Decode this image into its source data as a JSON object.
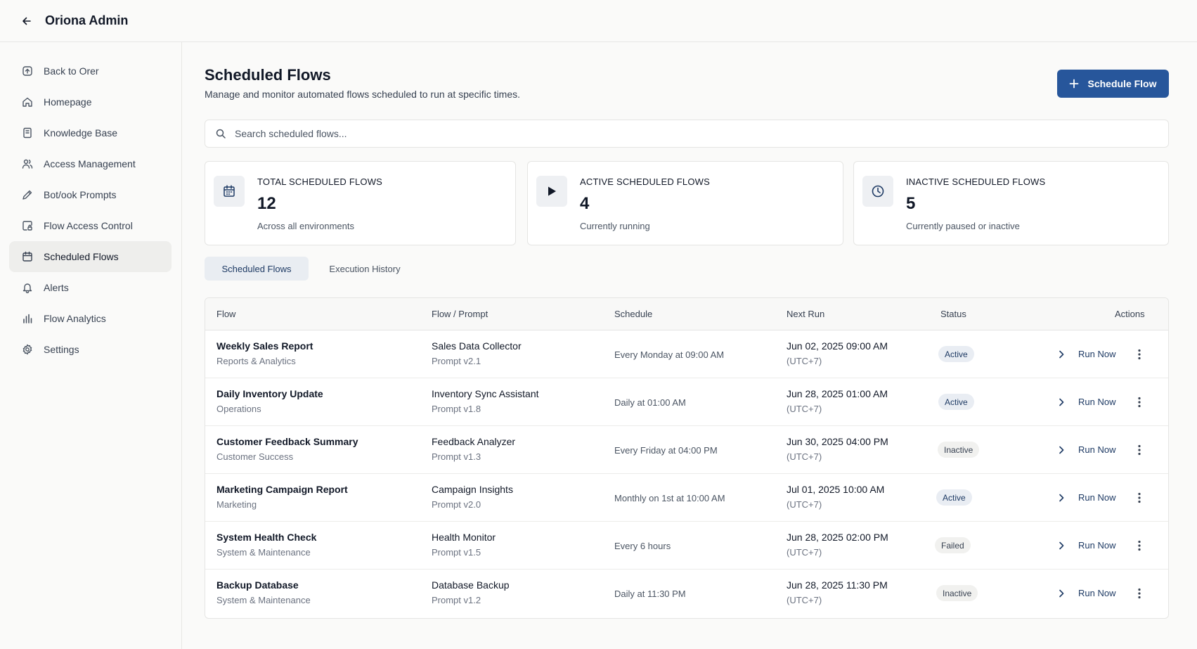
{
  "app": {
    "title": "Oriona Admin"
  },
  "sidebar": {
    "items": [
      {
        "label": "Back to Orer",
        "icon": "back-box-icon",
        "active": false
      },
      {
        "label": "Homepage",
        "icon": "home-icon",
        "active": false
      },
      {
        "label": "Knowledge Base",
        "icon": "book-icon",
        "active": false
      },
      {
        "label": "Access Management",
        "icon": "users-icon",
        "active": false
      },
      {
        "label": "Bot/ook Prompts",
        "icon": "pen-icon",
        "active": false
      },
      {
        "label": "Flow Access Control",
        "icon": "flow-lock-icon",
        "active": false
      },
      {
        "label": "Scheduled Flows",
        "icon": "calendar-icon",
        "active": true
      },
      {
        "label": "Alerts",
        "icon": "bell-icon",
        "active": false
      },
      {
        "label": "Flow Analytics",
        "icon": "bar-chart-icon",
        "active": false
      },
      {
        "label": "Settings",
        "icon": "gear-icon",
        "active": false
      }
    ]
  },
  "header": {
    "title": "Scheduled Flows",
    "subtitle": "Manage and monitor automated flows scheduled to run at specific times.",
    "primary_button": "Schedule Flow"
  },
  "search": {
    "placeholder": "Search scheduled flows..."
  },
  "stats": [
    {
      "label": "TOTAL SCHEDULED FLOWS",
      "value": "12",
      "desc": "Across all environments",
      "icon": "calendar-icon"
    },
    {
      "label": "ACTIVE SCHEDULED FLOWS",
      "value": "4",
      "desc": "Currently running",
      "icon": "play-icon"
    },
    {
      "label": "INACTIVE SCHEDULED FLOWS",
      "value": "5",
      "desc": "Currently paused or inactive",
      "icon": "clock-icon"
    }
  ],
  "tabs": [
    {
      "label": "Scheduled Flows",
      "active": true
    },
    {
      "label": "Execution History",
      "active": false
    }
  ],
  "table": {
    "columns": [
      "Flow",
      "Flow / Prompt",
      "Schedule",
      "Next Run",
      "Status",
      "Actions"
    ],
    "action_label": "Run Now",
    "rows": [
      {
        "flow": "Weekly Sales Report",
        "category": "Reports & Analytics",
        "prompt": "Sales Data Collector",
        "version": "Prompt v2.1",
        "schedule": "Every Monday at 09:00 AM",
        "next_run": "Jun 02, 2025 09:00 AM",
        "tz": "(UTC+7)",
        "status": "Active"
      },
      {
        "flow": "Daily Inventory Update",
        "category": "Operations",
        "prompt": "Inventory Sync Assistant",
        "version": "Prompt v1.8",
        "schedule": "Daily at 01:00 AM",
        "next_run": "Jun 28, 2025 01:00 AM",
        "tz": "(UTC+7)",
        "status": "Active"
      },
      {
        "flow": "Customer Feedback Summary",
        "category": "Customer Success",
        "prompt": "Feedback Analyzer",
        "version": "Prompt v1.3",
        "schedule": "Every Friday at 04:00 PM",
        "next_run": "Jun 30, 2025 04:00 PM",
        "tz": "(UTC+7)",
        "status": "Inactive"
      },
      {
        "flow": "Marketing Campaign Report",
        "category": "Marketing",
        "prompt": "Campaign Insights",
        "version": "Prompt v2.0",
        "schedule": "Monthly on 1st at 10:00 AM",
        "next_run": "Jul 01, 2025 10:00 AM",
        "tz": "(UTC+7)",
        "status": "Active"
      },
      {
        "flow": "System Health Check",
        "category": "System & Maintenance",
        "prompt": "Health Monitor",
        "version": "Prompt v1.5",
        "schedule": "Every 6 hours",
        "next_run": "Jun 28, 2025 02:00 PM",
        "tz": "(UTC+7)",
        "status": "Failed"
      },
      {
        "flow": "Backup Database",
        "category": "System & Maintenance",
        "prompt": "Database Backup",
        "version": "Prompt v1.2",
        "schedule": "Daily at 11:30 PM",
        "next_run": "Jun 28, 2025 11:30 PM",
        "tz": "(UTC+7)",
        "status": "Inactive"
      }
    ]
  },
  "colors": {
    "primary": "#27569b",
    "active_badge_text": "#1e3a64",
    "background": "#fafaf9"
  }
}
